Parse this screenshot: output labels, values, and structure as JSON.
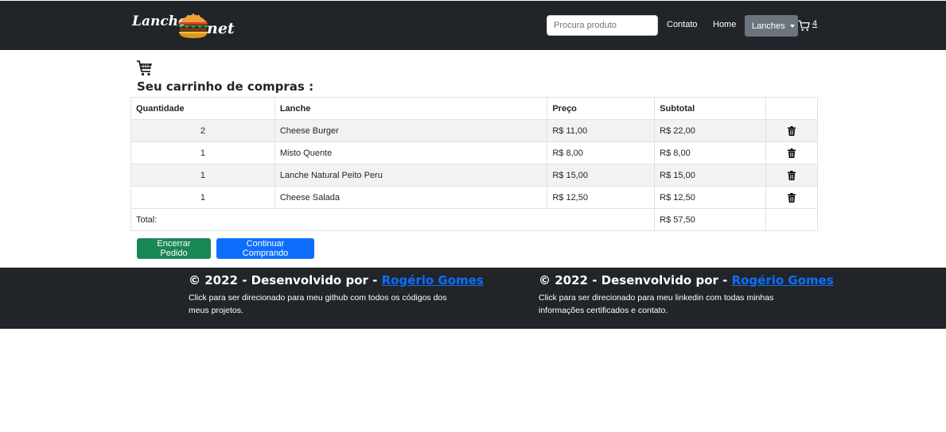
{
  "navbar": {
    "logo_text_1": "Lancho",
    "logo_text_2": "net",
    "search_placeholder": "Procura produto",
    "links": {
      "contato": "Contato",
      "home": "Home",
      "lanches": "Lanches"
    },
    "cart_count": "4"
  },
  "main": {
    "title": "Seu carrinho de compras :",
    "table": {
      "headers": {
        "quantidade": "Quantidade",
        "lanche": "Lanche",
        "preco": "Preço",
        "subtotal": "Subtotal"
      },
      "rows": [
        {
          "quantidade": "2",
          "lanche": "Cheese Burger",
          "preco": "R$ 11,00",
          "subtotal": "R$ 22,00"
        },
        {
          "quantidade": "1",
          "lanche": "Misto Quente",
          "preco": "R$ 8,00",
          "subtotal": "R$ 8,00"
        },
        {
          "quantidade": "1",
          "lanche": "Lanche Natural Peito Peru",
          "preco": "R$ 15,00",
          "subtotal": "R$ 15,00"
        },
        {
          "quantidade": "1",
          "lanche": "Cheese Salada",
          "preco": "R$ 12,50",
          "subtotal": "R$ 12,50"
        }
      ],
      "total_label": "Total:",
      "total_value": "R$ 57,50"
    },
    "buttons": {
      "encerrar": "Encerrar Pedido",
      "continuar": "Continuar Comprando"
    }
  },
  "footer": {
    "col1": {
      "title_prefix": "© 2022 - Desenvolvido por - ",
      "link": "Rogério Gomes",
      "desc": "Click para ser direcionado para meu github com todos os códigos dos meus projetos."
    },
    "col2": {
      "title_prefix": "© 2022 - Desenvolvido por - ",
      "link": "Rogério Gomes",
      "desc": "Click para ser direcionado para meu linkedin com todas minhas informações certificados e contato."
    }
  },
  "colors": {
    "navbar_bg": "#212529",
    "success": "#198754",
    "primary": "#0d6efd",
    "secondary": "#6c757d"
  },
  "icons": [
    "logo-burger-icon",
    "cart-icon",
    "trash-icon"
  ]
}
